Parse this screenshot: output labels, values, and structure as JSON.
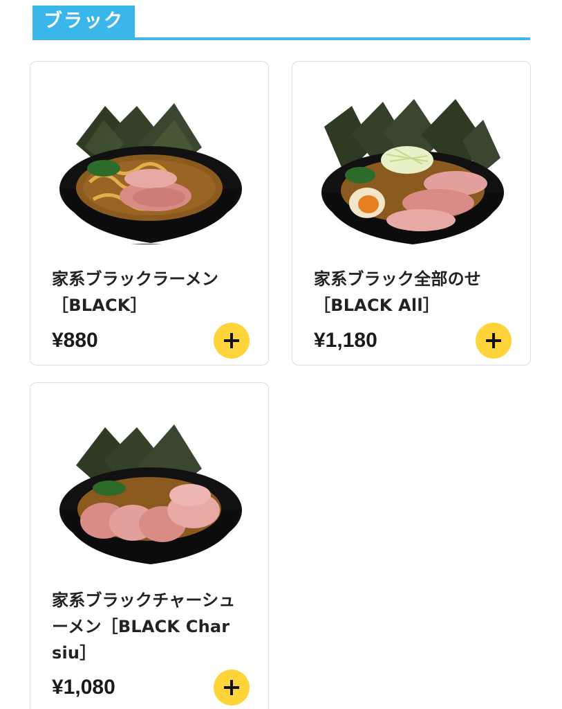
{
  "section": {
    "title": "ブラック",
    "accent_color": "#3bb6ea"
  },
  "items": [
    {
      "name": "家系ブラックラーメン\n［BLACK］",
      "price": "¥880",
      "add_icon": "plus-icon",
      "button_color": "#ffd43b"
    },
    {
      "name": "家系ブラック全部のせ\n［BLACK All］",
      "price": "¥1,180",
      "add_icon": "plus-icon",
      "button_color": "#ffd43b"
    },
    {
      "name": "家系ブラックチャーシュ\nーメン［BLACK Char\nsiu］",
      "price": "¥1,080",
      "add_icon": "plus-icon",
      "button_color": "#ffd43b"
    }
  ]
}
